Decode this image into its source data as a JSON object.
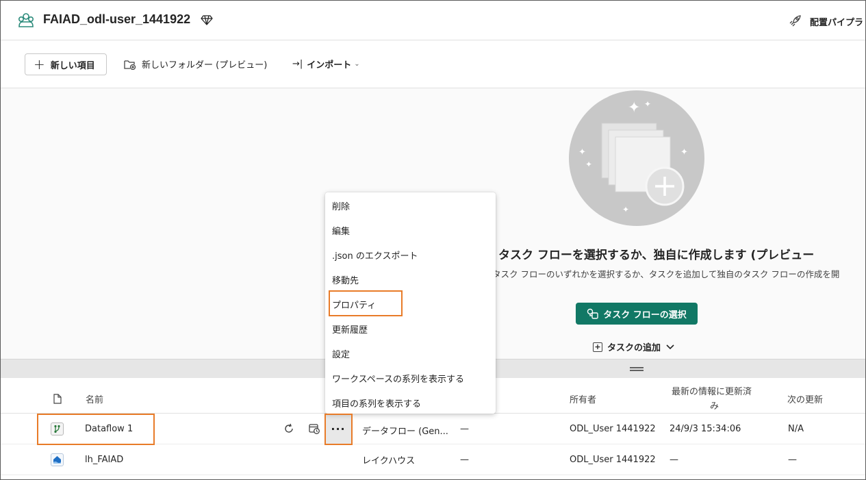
{
  "header": {
    "workspace_title": "FAIAD_odl-user_1441922",
    "deploy_label": "配置パイプラ"
  },
  "toolbar": {
    "new_item_label": "新しい項目",
    "new_folder_label": "新しいフォルダー (プレビュー)",
    "import_label": "インポート"
  },
  "taskflow": {
    "title": "タスク フローを選択するか、独自に作成します (プレビュー",
    "description": "タスク フローのいずれかを選択するか、タスクを追加して独自のタスク フローの作成を開",
    "select_button": "タスク フローの選択",
    "add_task": "タスクの追加"
  },
  "context_menu": {
    "items": [
      "削除",
      "編集",
      ".json のエクスポート",
      "移動先",
      "プロパティ",
      "更新履歴",
      "設定",
      "ワークスペースの系列を表示する",
      "項目の系列を表示する"
    ],
    "highlighted_index": 4
  },
  "table": {
    "columns": {
      "name": "名前",
      "owner": "所有者",
      "refreshed_line1": "最新の情報に更新済",
      "refreshed_line2": "み",
      "next_refresh": "次の更新"
    },
    "rows": [
      {
        "name": "Dataflow 1",
        "type": "データフロー (Gen...",
        "task": "—",
        "owner": "ODL_User 1441922",
        "refreshed": "24/9/3 15:34:06",
        "next": "N/A",
        "icon": "dataflow-icon",
        "color": "#2a7a3b"
      },
      {
        "name": "lh_FAIAD",
        "type": "レイクハウス",
        "task": "—",
        "owner": "ODL_User 1441922",
        "refreshed": "—",
        "next": "—",
        "icon": "lakehouse-icon",
        "color": "#1f6fc5"
      }
    ]
  },
  "colors": {
    "accent": "#117865",
    "highlight": "#e87b28"
  }
}
